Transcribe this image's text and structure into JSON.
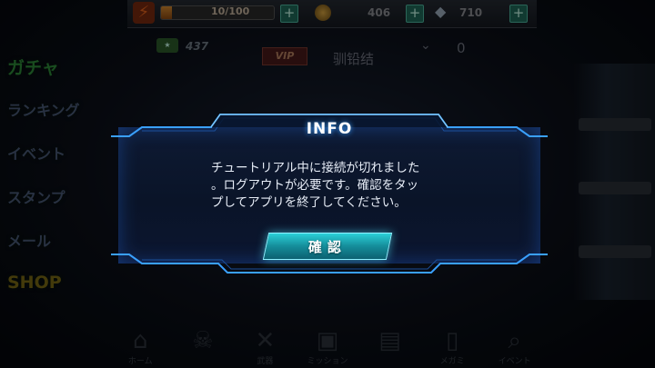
{
  "header": {
    "stamina": "10/100",
    "stamina_fill": 0.1,
    "coins": "406",
    "gems": "710",
    "plus_symbol": "+"
  },
  "player": {
    "rank_text": "437",
    "vip_label": "VIP",
    "name": "驯铅结",
    "count": "0"
  },
  "side_menu": {
    "items": [
      "ガチャ",
      "ランキング",
      "イベント",
      "スタンプ",
      "メール",
      "SHOP"
    ]
  },
  "bottom_nav": {
    "items": [
      {
        "label": "ホーム",
        "icon": "home-icon"
      },
      {
        "label": "",
        "icon": "skull-icon"
      },
      {
        "label": "武器",
        "icon": "weapon-icon"
      },
      {
        "label": "ミッション",
        "icon": "gift-icon"
      },
      {
        "label": "",
        "icon": "chest-icon"
      },
      {
        "label": "メガミ",
        "icon": "phone-icon"
      },
      {
        "label": "イベント",
        "icon": "search-icon"
      }
    ]
  },
  "dialog": {
    "title": "INFO",
    "message_lines": [
      "チュートリアル中に接続が切れました",
      "。ログアウトが必要です。確認をタッ",
      "プしてアプリを終了してください。"
    ],
    "confirm_label": "確認"
  },
  "colors": {
    "accent": "#2bd0d8",
    "frame_glow": "#3aa0ff",
    "background": "#05070d"
  }
}
